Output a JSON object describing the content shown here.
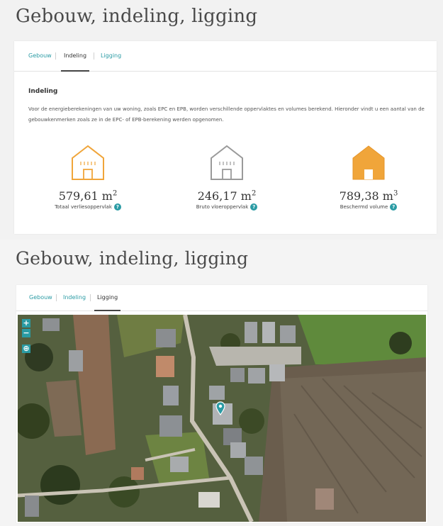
{
  "section1": {
    "title": "Gebouw, indeling, ligging",
    "tabs": [
      "Gebouw",
      "Indeling",
      "Ligging"
    ],
    "active_tab": "Indeling",
    "sub_heading": "Indeling",
    "description": "Voor de energieberekeningen van uw woning, zoals EPC en EPB, worden verschillende oppervlaktes en volumes berekend. Hieronder vindt u een aantal van de gebouwkenmerken zoals ze in de EPC- of EPB-berekening werden opgenomen.",
    "metrics": [
      {
        "value": "579,61",
        "unit": "m",
        "exponent": "2",
        "label": "Totaal verliesoppervlak",
        "icon": "house-outline-orange-icon"
      },
      {
        "value": "246,17",
        "unit": "m",
        "exponent": "2",
        "label": "Bruto vloeroppervlak",
        "icon": "house-outline-gray-icon"
      },
      {
        "value": "789,38",
        "unit": "m",
        "exponent": "3",
        "label": "Beschermd volume",
        "icon": "house-filled-orange-icon"
      }
    ],
    "help_glyph": "?"
  },
  "section2": {
    "title": "Gebouw, indeling, ligging",
    "tabs": [
      "Gebouw",
      "Indeling",
      "Ligging"
    ],
    "active_tab": "Ligging",
    "map": {
      "zoom_in": "+",
      "zoom_out": "−",
      "locate": "⊕",
      "marker": "location-pin-icon"
    }
  },
  "colors": {
    "accent": "#2a9ba4",
    "orange": "#f0a53a",
    "gray_icon": "#9a9a9a"
  }
}
